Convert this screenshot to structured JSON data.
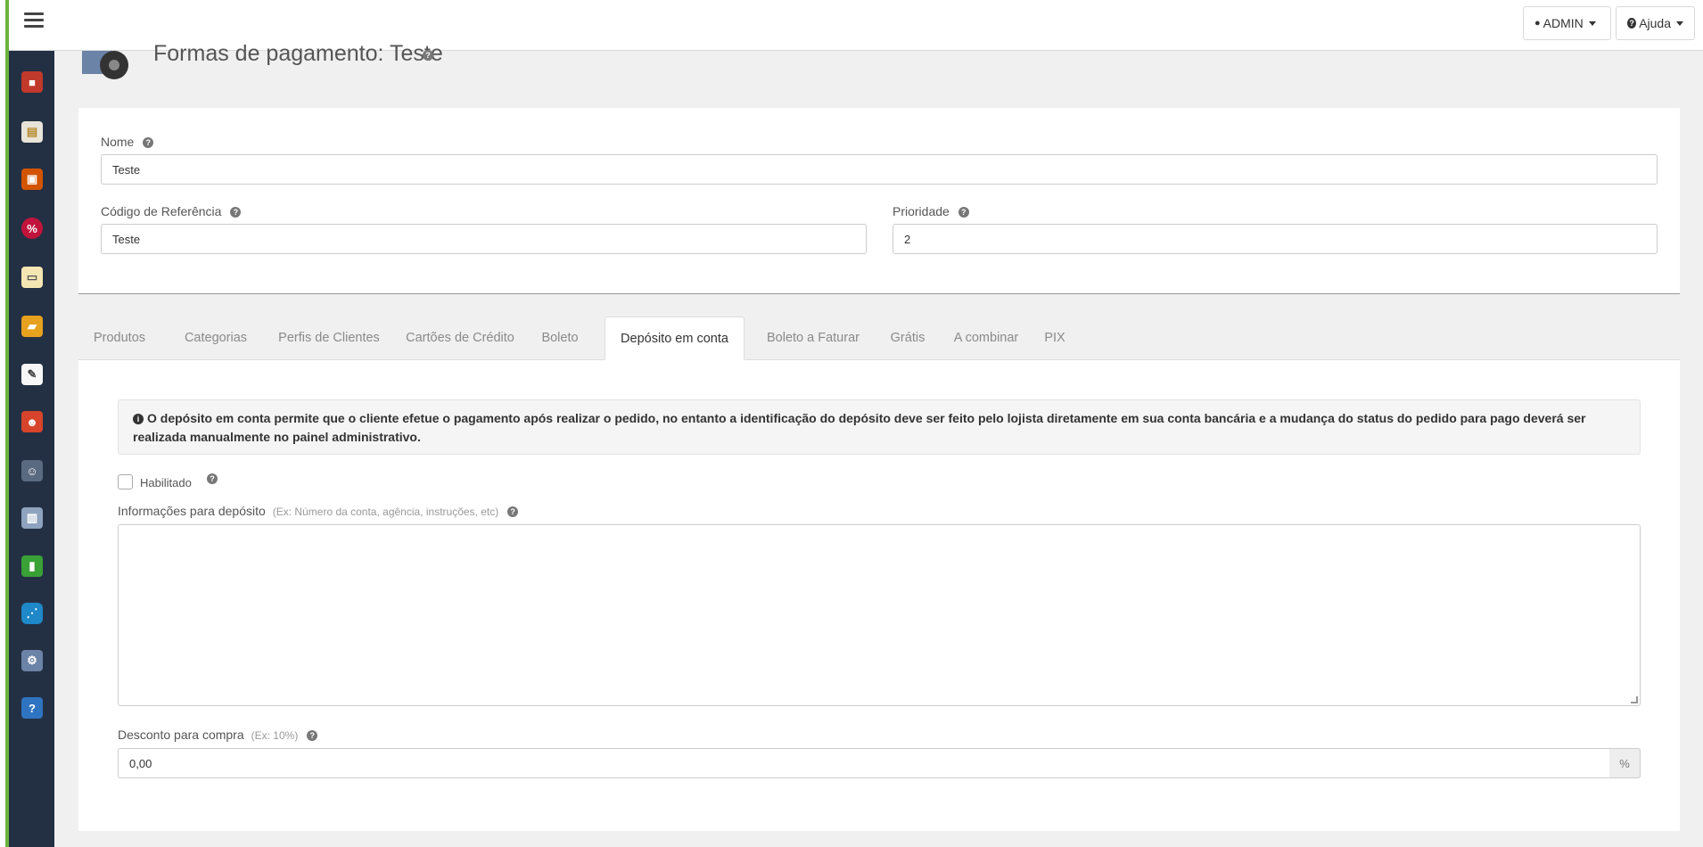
{
  "topbar": {
    "admin_label": "ADMIN",
    "help_label": "Ajuda"
  },
  "page": {
    "title": "Formas de pagamento: Teste"
  },
  "form": {
    "nome_label": "Nome",
    "nome_value": "Teste",
    "codigo_label": "Código de Referência",
    "codigo_value": "Teste",
    "prioridade_label": "Prioridade",
    "prioridade_value": "2"
  },
  "tabs": [
    {
      "label": "Produtos"
    },
    {
      "label": "Categorias"
    },
    {
      "label": "Perfis de Clientes"
    },
    {
      "label": "Cartões de Crédito"
    },
    {
      "label": "Boleto"
    },
    {
      "label": "Depósito em conta"
    },
    {
      "label": "Boleto a Faturar"
    },
    {
      "label": "Grátis"
    },
    {
      "label": "A combinar"
    },
    {
      "label": "PIX"
    }
  ],
  "deposito": {
    "alert_text": "O depósito em conta permite que o cliente efetue o pagamento após realizar o pedido, no entanto a identificação do depósito deve ser feito pelo lojista diretamente em sua conta bancária e a mudança do status do pedido para pago deverá ser realizada manualmente no painel administrativo.",
    "habilitado_label": "Habilitado",
    "info_label": "Informações para depósito",
    "info_hint": "(Ex: Número da conta, agência, instruções, etc)",
    "info_value": "",
    "desconto_label": "Desconto para compra",
    "desconto_hint": "(Ex: 10%)",
    "desconto_value": "0,00",
    "desconto_addon": "%"
  },
  "sidebar": {
    "icons": [
      "database-icon",
      "clipboard-icon",
      "box-icon",
      "promo-icon",
      "card-icon",
      "truck-icon",
      "note-icon",
      "users-icon",
      "user-icon",
      "server-icon",
      "chart-icon",
      "share-icon",
      "payment-icon",
      "help-book-icon"
    ]
  },
  "colors": {
    "sidebar": "#233044",
    "accent_strip": "#6cb33f"
  }
}
